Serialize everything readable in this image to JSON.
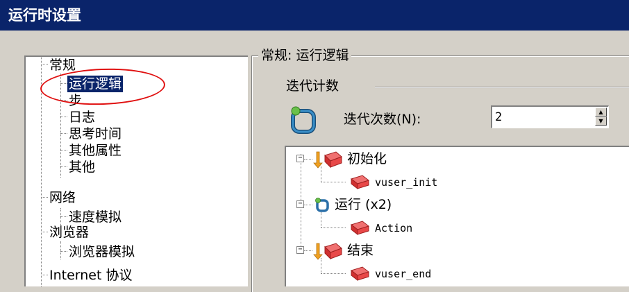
{
  "window": {
    "title": "运行时设置"
  },
  "left_tree": {
    "items": [
      {
        "label": "常规"
      },
      {
        "label": "运行逻辑"
      },
      {
        "label": "步"
      },
      {
        "label": "日志"
      },
      {
        "label": "思考时间"
      },
      {
        "label": "其他属性"
      },
      {
        "label": "其他"
      },
      {
        "label": "网络"
      },
      {
        "label": "速度模拟"
      },
      {
        "label": "浏览器"
      },
      {
        "label": "浏览器模拟"
      },
      {
        "label": "Internet 协议"
      }
    ]
  },
  "main": {
    "group_title": "常规: 运行逻辑",
    "iteration_section": "迭代计数",
    "iteration_label": "迭代次数(N):",
    "iteration_value": "2",
    "tree": {
      "init": {
        "label": "初始化",
        "child": "vuser_init"
      },
      "run": {
        "label": "运行 (x2)",
        "child": "Action"
      },
      "end": {
        "label": "结束",
        "child": "vuser_end"
      }
    }
  },
  "colors": {
    "titlebar": "#0a246a",
    "selection": "#0a246a",
    "annotation": "#e01010",
    "window_bg": "#d4d0c8"
  },
  "icons": {
    "block": "action-block-icon",
    "run": "run-loop-icon",
    "iteration": "iteration-loop-icon"
  }
}
